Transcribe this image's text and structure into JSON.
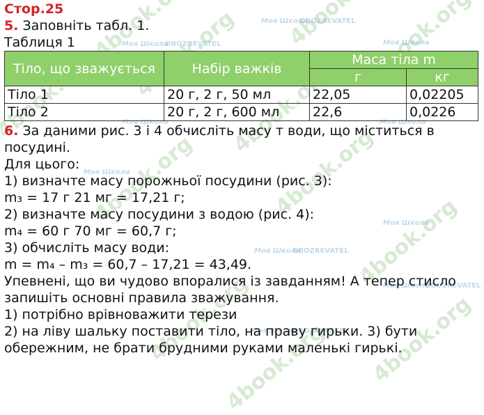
{
  "page_title": "Стор.25",
  "task5": {
    "number": "5.",
    "text": "Заповніть табл. 1.",
    "table_caption": "Таблиця 1",
    "headers": {
      "body": "Тіло, що зважується",
      "weights": "Набір важків",
      "mass": "Маса тіла m",
      "unit_g": "г",
      "unit_kg": "кг"
    },
    "rows": [
      {
        "body": "Тіло 1",
        "weights": "20 г, 2 г, 50 мл",
        "grams": "22,05",
        "kg": "0,02205"
      },
      {
        "body": "Тіло 2",
        "weights": "20 г, 2 г, 600 мл",
        "grams": "22,6",
        "kg": "0,0226"
      }
    ]
  },
  "task6": {
    "number": "6.",
    "text_a": " За даними рис. 3 і 4 обчисліть масу т води, що міститься в",
    "text_b": "посудині.",
    "lines": [
      "Для цього:",
      "1) визначте масу порожньої посудини (рис. 3):",
      "m₃ = 17 г 21 мг = 17,21 г;",
      "2) визначте масу посудини з водою (рис. 4):",
      "m₄ = 60 г 70 мг = 60,7 г;",
      "3) обчисліть масу води:",
      "m = m₄ – m₃ = 60,7 – 17,21 = 43,49.",
      "Упевнені, що ви чудово впоралися із завданням! А тепер стисло",
      "запишіть основні правила зважування.",
      "1) потрібно врівноважити терези",
      "2) на ліву шальку поставити тіло, на праву гирьки. 3) бути",
      "обережним, не брати брудними руками маленькі гирькі."
    ]
  },
  "watermarks": {
    "site": "4book.org",
    "school": "Моя Школа",
    "news": "OBOZREVATEL"
  }
}
